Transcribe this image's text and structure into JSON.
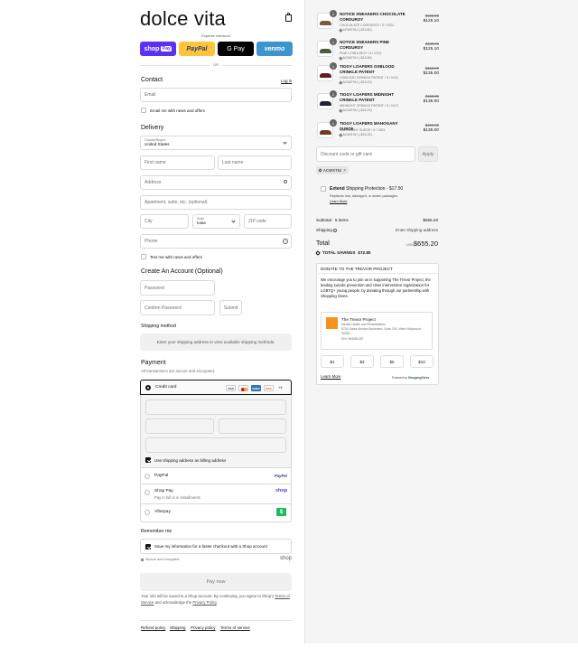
{
  "brand": {
    "logo": "dolce vita"
  },
  "express": {
    "label": "Express checkout",
    "buttons": [
      "shop",
      "Pay",
      "PayPal",
      "G Pay",
      "venmo"
    ],
    "colors": {
      "shop": "#5a31f4",
      "paypal": "#ffc439",
      "gpay": "#000000",
      "venmo": "#3d95ce"
    },
    "or": "OR"
  },
  "contact": {
    "title": "Contact",
    "login": "Log in",
    "email_placeholder": "Email",
    "news": "Email me with news and offers"
  },
  "delivery": {
    "title": "Delivery",
    "country_label": "Country/Region",
    "country": "United States",
    "first": "First name",
    "last": "Last name",
    "address": "Address",
    "apt": "Apartment, suite, etc. (optional)",
    "city": "City",
    "state_label": "State",
    "state": "Iowa",
    "zip": "ZIP code",
    "phone": "Phone",
    "text_news": "Text me with news and offers"
  },
  "account": {
    "title": "Create An Account (Optional)",
    "password": "Password",
    "confirm": "Confirm Password",
    "submit": "Submit"
  },
  "shipping_method": {
    "title": "Shipping method",
    "placeholder": "Enter your shipping address to view available shipping methods."
  },
  "payment": {
    "title": "Payment",
    "subtitle": "All transactions are secure and encrypted.",
    "credit_card": "Credit card",
    "card_icons": [
      "VISA",
      "MC",
      "AMEX",
      "DISC",
      "+4"
    ],
    "billing_same": "Use shipping address as billing address",
    "paypal": "PayPal",
    "paypal_logo": "PayPal",
    "shoppay": "Shop Pay",
    "shoppay_sub": "Pay in full or in installments",
    "shoppay_logo": "shop",
    "afterpay": "Afterpay",
    "afterpay_icon": "$"
  },
  "remember": {
    "title": "Remember me",
    "save": "Save my information for a faster checkout with a Shop account",
    "secure": "Secure and encrypted",
    "shop_logo": "shop"
  },
  "pay_now": "Pay now",
  "legal": {
    "line1": "Your info will be saved to a Shop account. By continuing, you agree to Shop's",
    "terms": "Terms of Service",
    "mid": " and acknowledge the ",
    "privacy": "Privacy Policy",
    "end": "."
  },
  "footer": [
    "Refund policy",
    "Shipping",
    "Privacy policy",
    "Terms of service"
  ],
  "cart": {
    "items": [
      {
        "qty": "1",
        "name": "NOTICE SNEAKERS CHOCOLATE CORDUROY",
        "variant": "CHOCOLATE CORDUROY / 5 / V201",
        "discount": "ACWX76J (-$13.80)",
        "orig": "$138.00",
        "price": "$125.10",
        "color": "#7a5a3c"
      },
      {
        "qty": "1",
        "name": "NOTICE SNEAKERS PINE CORDUROY",
        "variant": "PINE CORDUROY / 5 / V201",
        "discount": "ACWX76J (-$13.80)",
        "orig": "$138.00",
        "price": "$125.10",
        "color": "#4e5a3a"
      },
      {
        "qty": "1",
        "name": "TIGGY LOAFERS OXBLOOD CRINKLE PATENT",
        "variant": "OXBLOOD CRINKLE PATENT / 5 / V411",
        "discount": "ACWX76J (-$15.00)",
        "orig": "$150.00",
        "price": "$135.00",
        "color": "#5a1f20"
      },
      {
        "qty": "1",
        "name": "TIGGY LOAFERS MIDNIGHT CRINKLE PATENT",
        "variant": "MIDNIGHT CRINKLE PATENT / 5 / V417",
        "discount": "ACWX76J (-$15.00)",
        "orig": "$150.00",
        "price": "$135.00",
        "color": "#1f2233"
      },
      {
        "qty": "1",
        "name": "TIGGY LOAFERS MAHOGANY SUEDE",
        "variant": "MAHOGANY SUEDE / 5 / V601",
        "discount": "ACWX76J (-$15.00)",
        "orig": "$150.00",
        "price": "$135.00",
        "color": "#6b3b24"
      }
    ],
    "discount_placeholder": "Discount code or gift card",
    "apply": "Apply",
    "code_tag": "ACWX76J",
    "protection": {
      "brand": "Extend",
      "title": "Shipping Protection",
      "price": "- $17.50",
      "desc": "Replaces lost, damaged, or stolen packages.",
      "learn": "Learn More"
    },
    "subtotal_label": "Subtotal · 5 items",
    "subtotal": "$655.20",
    "shipping_label": "Shipping",
    "shipping_value": "Enter shipping address",
    "total_label": "Total",
    "currency": "USD",
    "total": "$655.20",
    "savings_label": "TOTAL SAVINGS",
    "savings": "$72.80"
  },
  "donate": {
    "title": "DONATE TO THE TREVOR PROJECT",
    "text": "We encourage you to join us in supporting The Trevor Project, the leading suicide prevention and crisis intervention organization for LGBTQ+ young people, by donating through our partnership with Shopping Gives.",
    "org": "The Trevor Project",
    "org_cat": "Mental Health and Rehabilitation",
    "org_addr": "8704 Santa Monica Boulevard, Suite 200, West Hollywood, 90069",
    "org_ein": "EIN: 954681287",
    "amounts": [
      "$1",
      "$3",
      "$5",
      "$10"
    ],
    "learn": "Learn More",
    "powered": "Powered by",
    "powered_brand": "ShoppingGives"
  }
}
